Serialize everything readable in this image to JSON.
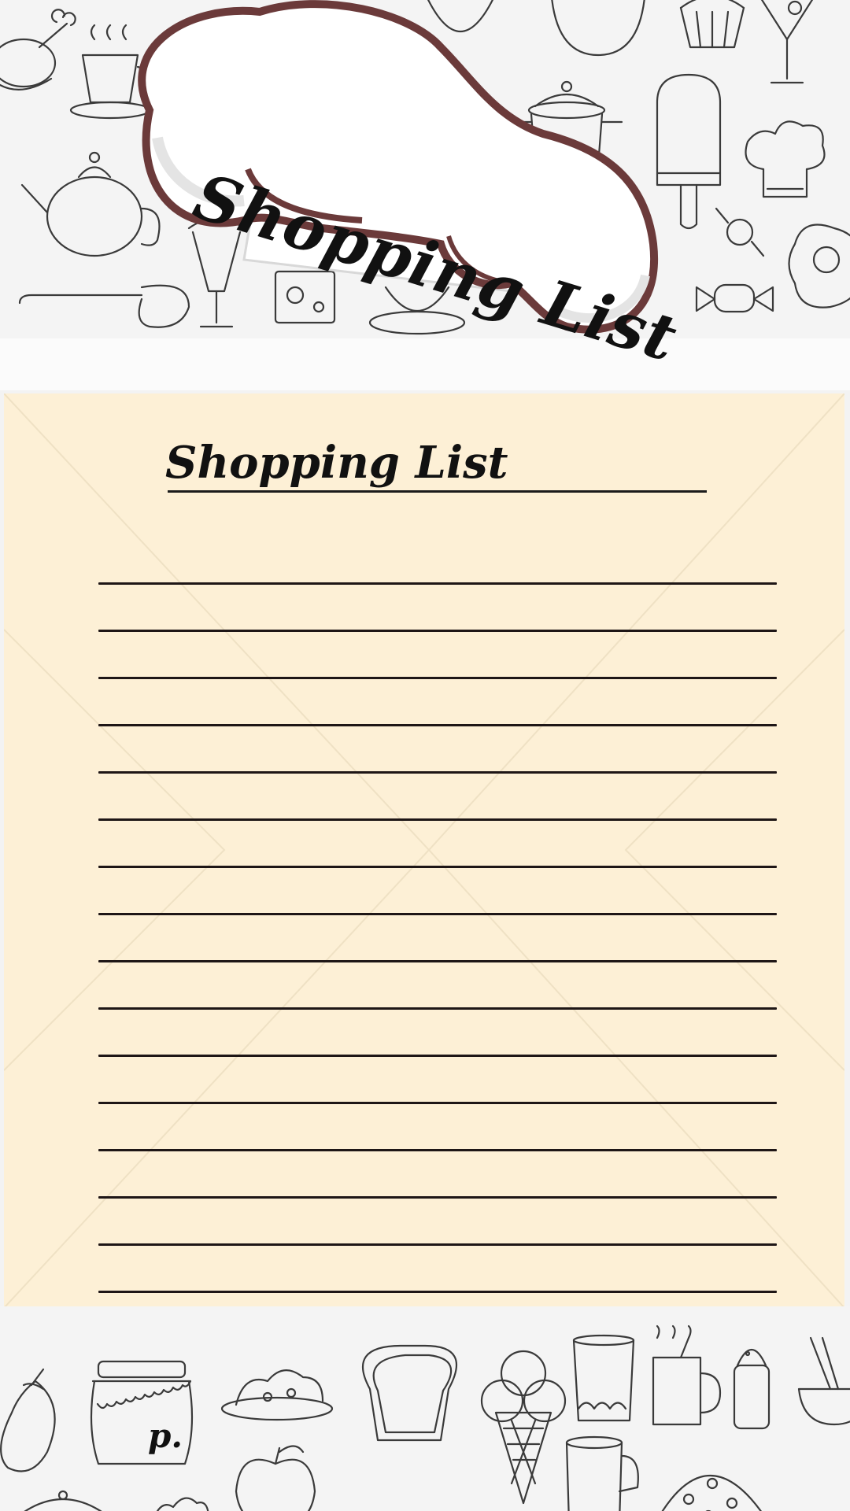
{
  "banner": {
    "title": "Shopping List"
  },
  "paper": {
    "title": "Shopping List",
    "line_count": 16
  },
  "footer": {
    "jar_label": "p."
  },
  "colors": {
    "paper": "#fdf0d6",
    "background": "#f4f4f4",
    "hat_outline": "#6b3a3a",
    "ink": "#111111"
  },
  "icons": {
    "top_band": [
      "turkey-leg-icon",
      "steaming-cup-icon",
      "teapot-icon",
      "ladle-icon",
      "ice-cream-cup-icon",
      "cheese-icon",
      "teacup-icon",
      "cooking-pot-icon",
      "cupcake-icon",
      "cocktail-glass-icon",
      "popsicle-icon",
      "chef-hat-icon",
      "candy-icon",
      "fried-egg-icon"
    ],
    "bottom_band": [
      "eggplant-icon",
      "jam-jar-icon",
      "salad-plate-icon",
      "toast-icon",
      "ice-cream-cone-icon",
      "glass-icon",
      "mug-icon",
      "salt-shaker-icon",
      "noodle-bowl-icon",
      "apple-icon",
      "pizza-icon"
    ]
  }
}
